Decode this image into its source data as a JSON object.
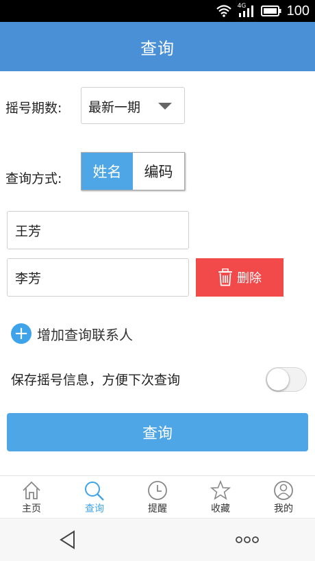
{
  "status_bar": {
    "network": "4G",
    "battery": "100"
  },
  "header": {
    "title": "查询"
  },
  "form": {
    "period_label": "摇号期数:",
    "period_value": "最新一期",
    "method_label": "查询方式:",
    "method_options": [
      "姓名",
      "编码"
    ],
    "method_selected": "姓名",
    "names": [
      "王芳",
      "李芳"
    ],
    "delete_label": "删除",
    "add_label": "增加查询联系人",
    "save_label": "保存摇号信息，方便下次查询",
    "save_toggle_on": false,
    "submit_label": "查询"
  },
  "tabbar": {
    "items": [
      {
        "label": "主页",
        "icon": "home-icon"
      },
      {
        "label": "查询",
        "icon": "search-icon"
      },
      {
        "label": "提醒",
        "icon": "clock-icon"
      },
      {
        "label": "收藏",
        "icon": "star-icon"
      },
      {
        "label": "我的",
        "icon": "user-icon"
      }
    ],
    "active_index": 1
  },
  "colors": {
    "header": "#4a90d6",
    "accent": "#4ea6e6",
    "delete": "#f24a4a"
  }
}
